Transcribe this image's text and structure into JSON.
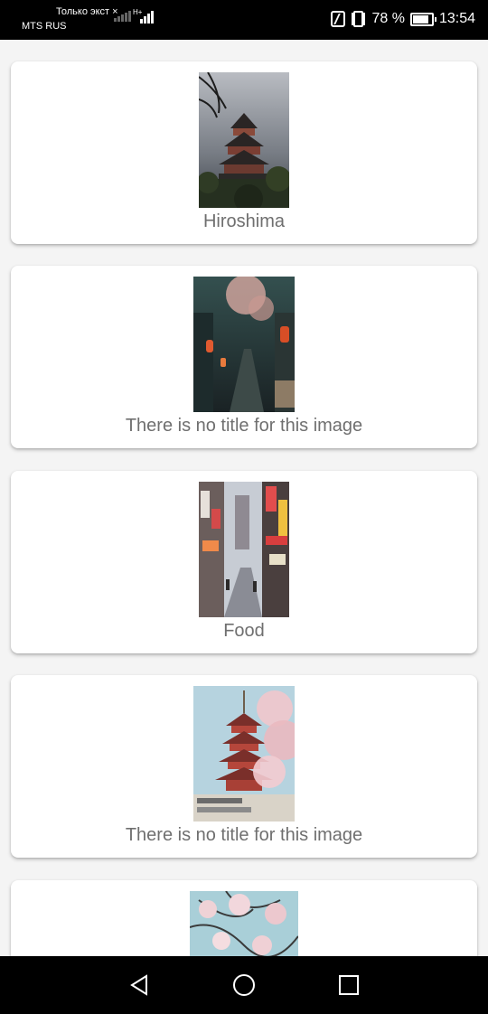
{
  "status_bar": {
    "notification": "Только экст",
    "carrier": "MTS RUS",
    "network_type": "H+",
    "battery": "78 %",
    "time": "13:54"
  },
  "feed": {
    "items": [
      {
        "title": "Hiroshima",
        "image": "hiroshima-castle"
      },
      {
        "title": "There is no title for this image",
        "image": "lantern-alley"
      },
      {
        "title": "Food",
        "image": "neon-street"
      },
      {
        "title": "There is no title for this image",
        "image": "pagoda-blossoms"
      },
      {
        "title": "",
        "image": "cherry-blossom-branches"
      }
    ]
  },
  "nav_bar": {
    "icons": [
      "back-icon",
      "home-icon",
      "recents-icon"
    ]
  }
}
